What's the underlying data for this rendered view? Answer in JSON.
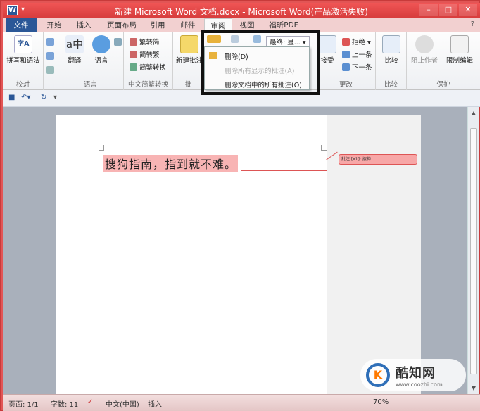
{
  "window": {
    "app_icon": "W",
    "title": "新建 Microsoft Word 文档.docx - Microsoft Word(产品激活失败)",
    "min": "–",
    "max": "□",
    "close": "✕"
  },
  "tabs": [
    {
      "label": "文件"
    },
    {
      "label": "开始"
    },
    {
      "label": "插入"
    },
    {
      "label": "页面布局"
    },
    {
      "label": "引用"
    },
    {
      "label": "邮件"
    },
    {
      "label": "审阅"
    },
    {
      "label": "视图"
    },
    {
      "label": "福昕PDF"
    }
  ],
  "help_icon": "?",
  "ribbon": {
    "proofing": {
      "spell": "拼写和语法",
      "group": "校对"
    },
    "language": {
      "translate": "翻译",
      "language": "语言",
      "group": "语言"
    },
    "chinese": {
      "t2s": "繁转简",
      "s2t": "简转繁",
      "convert": "简繁转换",
      "group": "中文简繁转换"
    },
    "comments": {
      "new": "新建批注",
      "group": "批"
    },
    "tracking": {
      "display": "最终: 显..."
    },
    "changes": {
      "accept": "接受",
      "reject": "拒绝",
      "prev": "上一条",
      "next": "下一条",
      "group": "更改"
    },
    "compare": {
      "label": "比较",
      "group": "比较"
    },
    "protect": {
      "block": "阻止作者",
      "restrict": "限制编辑",
      "group": "保护"
    }
  },
  "dropdown": {
    "items": [
      {
        "label": "删除(D)",
        "enabled": true
      },
      {
        "label": "删除所有显示的批注(A)",
        "enabled": false
      },
      {
        "label": "删除文档中的所有批注(O)",
        "enabled": true
      }
    ]
  },
  "document": {
    "text": "搜狗指南，指到就不难。",
    "comment_bubble": "批注 [x1]: 搜狗"
  },
  "status": {
    "page": "页面: 1/1",
    "words": "字数: 11",
    "lang": "中文(中国)",
    "mode": "插入",
    "zoom": "70%"
  },
  "watermark": {
    "brand": "酷知网",
    "url": "www.coozhi.com"
  },
  "colors": {
    "title_bar": "#e04848",
    "file_tab": "#2b5797",
    "comment_fill": "#f7a7a7"
  }
}
